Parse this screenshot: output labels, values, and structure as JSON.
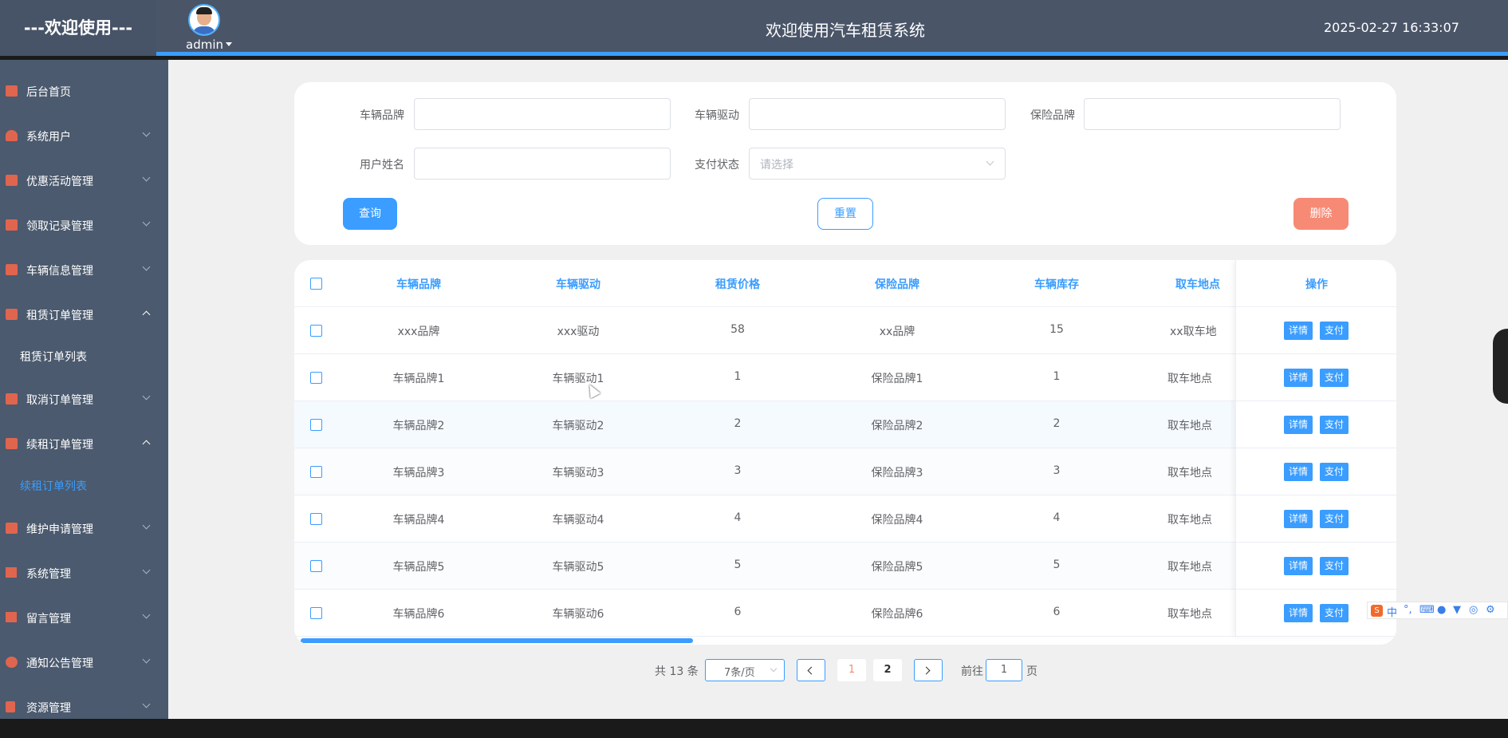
{
  "header": {
    "brand": "---欢迎使用---",
    "user": "admin",
    "title": "欢迎使用汽车租赁系统",
    "datetime": "2025-02-27 16:33:07"
  },
  "sidebar": {
    "items": [
      {
        "label": "后台首页",
        "icon": "monitor-icon"
      },
      {
        "label": "系统用户",
        "icon": "user-icon"
      },
      {
        "label": "优惠活动管理",
        "icon": "chart-line-icon"
      },
      {
        "label": "领取记录管理",
        "icon": "chart-line-icon"
      },
      {
        "label": "车辆信息管理",
        "icon": "chart-line-icon"
      },
      {
        "label": "租赁订单管理",
        "icon": "chart-line-icon",
        "expanded": true
      },
      {
        "label": "取消订单管理",
        "icon": "chart-line-icon"
      },
      {
        "label": "续租订单管理",
        "icon": "chart-line-icon",
        "expanded": true
      },
      {
        "label": "维护申请管理",
        "icon": "chart-line-icon"
      },
      {
        "label": "系统管理",
        "icon": "bar-chart-icon"
      },
      {
        "label": "留言管理",
        "icon": "bar-chart-icon"
      },
      {
        "label": "通知公告管理",
        "icon": "info-icon"
      },
      {
        "label": "资源管理",
        "icon": "flag-icon"
      }
    ],
    "sub_items": [
      {
        "label": "租赁订单列表",
        "active": false
      },
      {
        "label": "续租订单列表",
        "active": true
      }
    ]
  },
  "search": {
    "brand_label": "车辆品牌",
    "brand_value": "",
    "drive_label": "车辆驱动",
    "drive_value": "",
    "insurance_label": "保险品牌",
    "insurance_value": "",
    "username_label": "用户姓名",
    "username_value": "",
    "pay_status_label": "支付状态",
    "pay_status_placeholder": "请选择",
    "query_button": "查询",
    "reset_button": "重置",
    "delete_button": "删除"
  },
  "table": {
    "columns": [
      "车辆品牌",
      "车辆驱动",
      "租赁价格",
      "保险品牌",
      "车辆库存",
      "取车地点"
    ],
    "op_column": "操作",
    "detail_button": "详情",
    "pay_button": "支付",
    "rows": [
      [
        "xxx品牌",
        "xxx驱动",
        "58",
        "xx品牌",
        "15",
        "xx取车地"
      ],
      [
        "车辆品牌1",
        "车辆驱动1",
        "1",
        "保险品牌1",
        "1",
        "取车地点"
      ],
      [
        "车辆品牌2",
        "车辆驱动2",
        "2",
        "保险品牌2",
        "2",
        "取车地点"
      ],
      [
        "车辆品牌3",
        "车辆驱动3",
        "3",
        "保险品牌3",
        "3",
        "取车地点"
      ],
      [
        "车辆品牌4",
        "车辆驱动4",
        "4",
        "保险品牌4",
        "4",
        "取车地点"
      ],
      [
        "车辆品牌5",
        "车辆驱动5",
        "5",
        "保险品牌5",
        "5",
        "取车地点"
      ],
      [
        "车辆品牌6",
        "车辆驱动6",
        "6",
        "保险品牌6",
        "6",
        "取车地点"
      ]
    ]
  },
  "pagination": {
    "total_text": "共 13 条",
    "page_size": "7条/页",
    "pages": [
      "1",
      "2"
    ],
    "current_page": "1",
    "goto_prefix": "前往",
    "goto_value": "1",
    "goto_suffix": "页"
  },
  "ime": {
    "mode": "中"
  },
  "colors": {
    "accent": "#3a9dff",
    "header_bg": "#4a5568",
    "sidebar_bg": "#4b5a6e",
    "icon": "#e0654f",
    "delete": "#f78a75"
  }
}
